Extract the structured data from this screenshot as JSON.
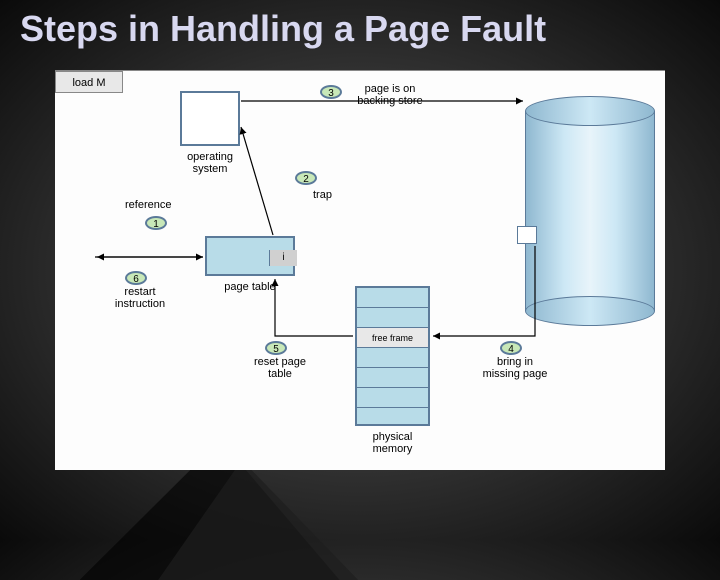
{
  "title": "Steps in Handling a Page Fault",
  "labels": {
    "operating_system": "operating\nsystem",
    "reference": "reference",
    "trap": "trap",
    "page_on_store": "page is on\nbacking store",
    "load_m": "load M",
    "page_table": "page table",
    "restart": "restart\ninstruction",
    "reset": "reset page\ntable",
    "bring_in": "bring in\nmissing page",
    "physical_memory": "physical\nmemory",
    "free_frame": "free frame",
    "invalid_bit": "i"
  },
  "steps": {
    "s1": "1",
    "s2": "2",
    "s3": "3",
    "s4": "4",
    "s5": "5",
    "s6": "6"
  }
}
